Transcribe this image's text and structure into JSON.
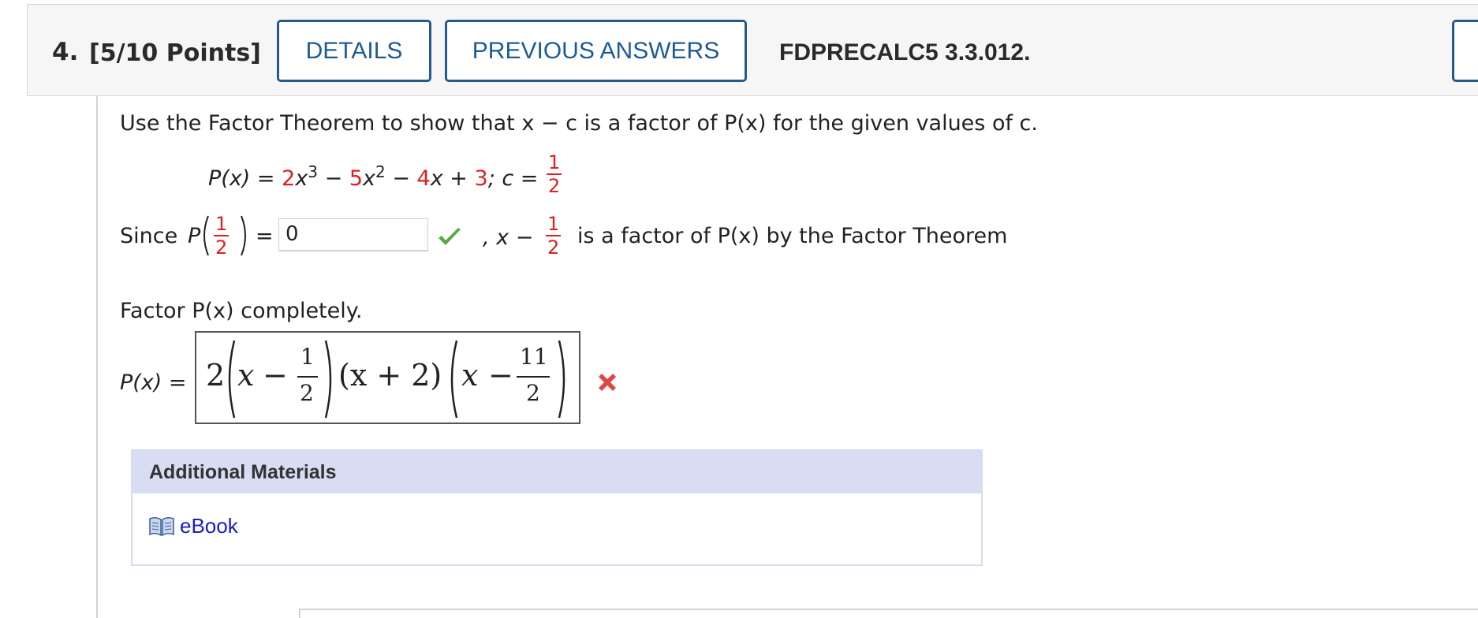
{
  "header": {
    "question_number": "4.",
    "points": "[5/10 Points]",
    "details_label": "DETAILS",
    "previous_answers_label": "PREVIOUS ANSWERS",
    "question_code": "FDPRECALC5 3.3.012."
  },
  "prompt": {
    "intro": "Use the Factor Theorem to show that x − c is a factor of P(x) for the given values of c.",
    "poly_lhs": "P(x) = ",
    "coef1": "2",
    "term1": "x",
    "exp1": "3",
    "op1": " − ",
    "coef2": "5",
    "term2": "x",
    "exp2": "2",
    "op2": " − ",
    "coef3": "4",
    "term3": "x + ",
    "coef4": "3",
    "c_label": "; c = ",
    "c_num": "1",
    "c_den": "2"
  },
  "part1": {
    "since": "Since",
    "p_label": "P",
    "frac_num": "1",
    "frac_den": "2",
    "equals": "=",
    "answer_value": "0",
    "answer_status": "correct",
    "after_comma": ", x −",
    "after_num": "1",
    "after_den": "2",
    "conclusion": "is a factor of P(x) by the Factor Theorem"
  },
  "part2": {
    "instruction": "Factor P(x) completely.",
    "lhs": "P(x) =",
    "answer_expression": "2(x − 1/2)(x + 2)(x − 11/2)",
    "expr": {
      "lead": "2",
      "x1": "x",
      "minus1": "−",
      "n1": "1",
      "d1": "2",
      "mid": "(x + 2)",
      "x3": "x",
      "minus3": "−",
      "n3": "11",
      "d3": "2"
    },
    "answer_status": "incorrect"
  },
  "materials": {
    "heading": "Additional Materials",
    "ebook_label": "eBook"
  },
  "colors": {
    "accent": "#245b8e",
    "highlight_red": "#e02020",
    "correct_green": "#5aa844",
    "incorrect_red": "#e04848",
    "materials_header": "#d8ddf4",
    "link": "#1a1acc"
  },
  "icons": [
    "check-icon",
    "x-mark-icon",
    "book-icon"
  ]
}
